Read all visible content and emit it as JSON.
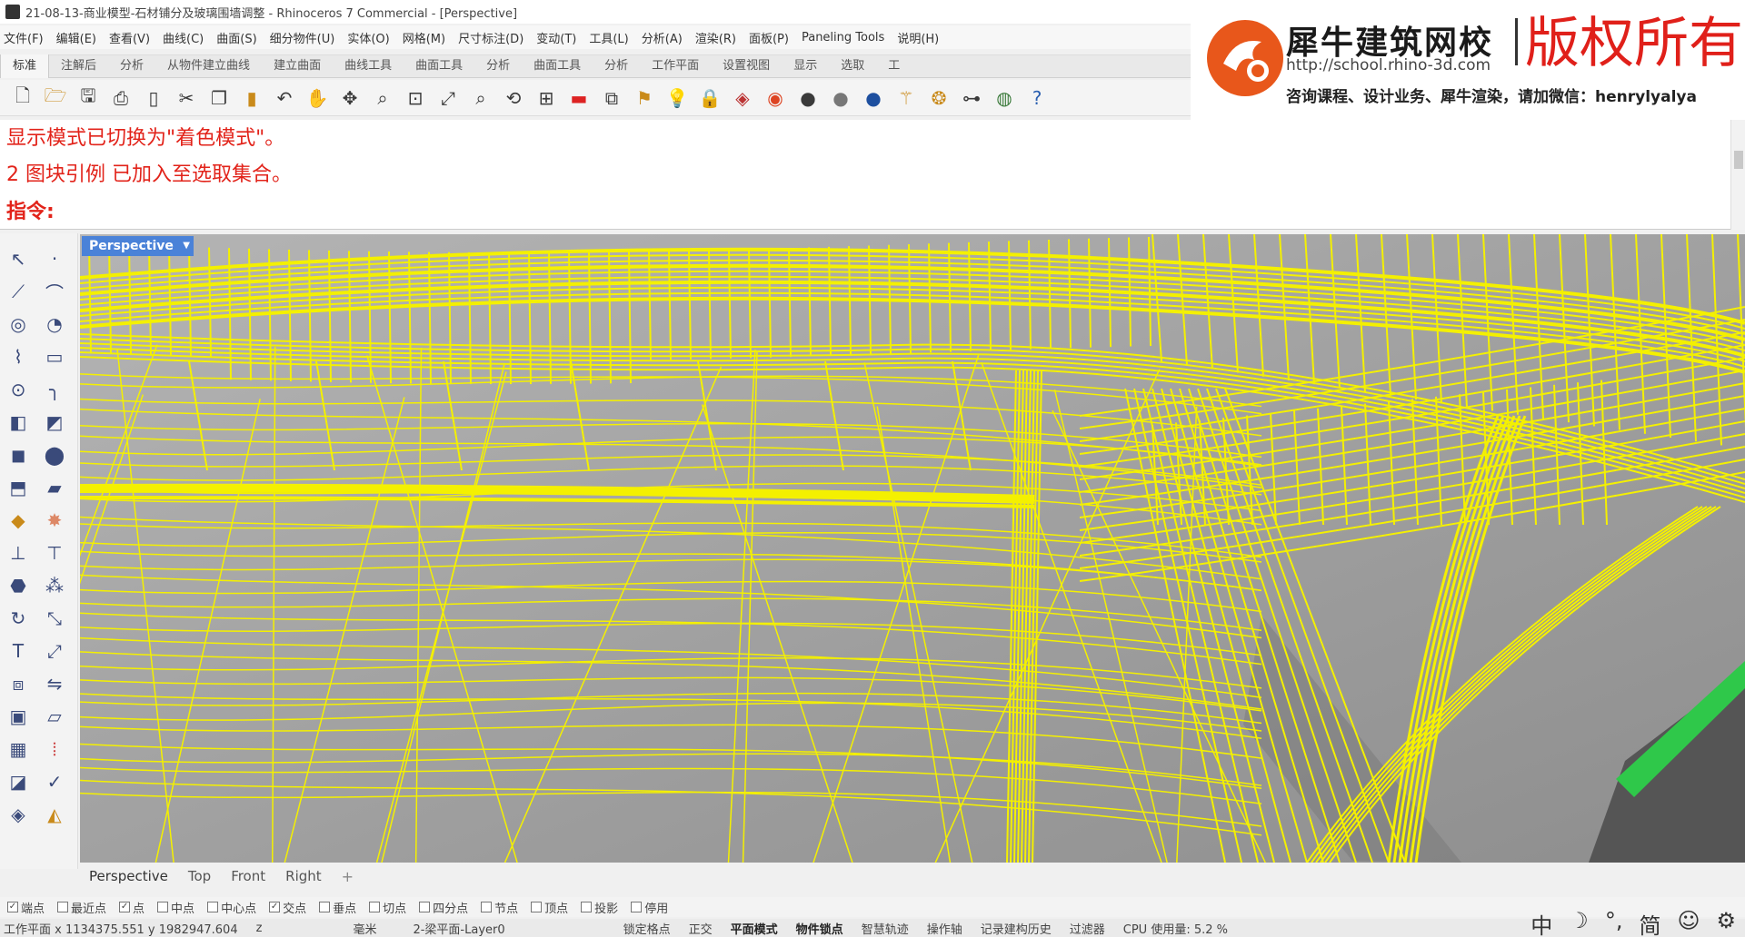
{
  "window": {
    "title": "21-08-13-商业模型-石材铺分及玻璃围墙调整 - Rhinoceros 7 Commercial - [Perspective]"
  },
  "menu": [
    "文件(F)",
    "编辑(E)",
    "查看(V)",
    "曲线(C)",
    "曲面(S)",
    "细分物件(U)",
    "实体(O)",
    "网格(M)",
    "尺寸标注(D)",
    "变动(T)",
    "工具(L)",
    "分析(A)",
    "渲染(R)",
    "面板(P)",
    "Paneling Tools",
    "说明(H)"
  ],
  "tabs": [
    "标准",
    "注解后",
    "分析",
    "从物件建立曲线",
    "建立曲面",
    "曲线工具",
    "曲面工具",
    "分析",
    "曲面工具",
    "分析",
    "工作平面",
    "设置视图",
    "显示",
    "选取",
    "工"
  ],
  "toolbar_icons": [
    "new-file-icon",
    "open-icon",
    "save-icon",
    "print-icon",
    "new-layout-icon",
    "cut-icon",
    "copy-icon",
    "paste-icon",
    "undo-icon",
    "pan-icon",
    "move-icon",
    "zoom-icon",
    "zoom-window-icon",
    "zoom-extents-icon",
    "zoom-selected-icon",
    "rotate-view-icon",
    "four-view-icon",
    "red-line-icon",
    "layer-icon",
    "properties-icon",
    "light-icon",
    "lock-icon",
    "material-icon",
    "color-wheel-icon",
    "sphere-dark-icon",
    "sphere-gray-icon",
    "sphere-blue-icon",
    "wand-icon",
    "render-icon",
    "hierarchy-icon",
    "globe-icon",
    "help-icon"
  ],
  "watermark": {
    "name": "犀牛建筑网校",
    "rights": "版权所有",
    "url": "http://school.rhino-3d.com",
    "services": "咨询课程、设计业务、犀牛渲染，请加微信：henrylyalya"
  },
  "command": {
    "line1": "显示模式已切换为\"着色模式\"。",
    "line2": "2 图块引例 已加入至选取集合。",
    "prompt": "指令:",
    "input_value": ""
  },
  "viewport": {
    "label": "Perspective"
  },
  "view_tabs": [
    "Perspective",
    "Top",
    "Front",
    "Right"
  ],
  "osnaps": [
    {
      "label": "端点",
      "checked": true
    },
    {
      "label": "最近点",
      "checked": false
    },
    {
      "label": "点",
      "checked": true
    },
    {
      "label": "中点",
      "checked": false
    },
    {
      "label": "中心点",
      "checked": false
    },
    {
      "label": "交点",
      "checked": true
    },
    {
      "label": "垂点",
      "checked": false
    },
    {
      "label": "切点",
      "checked": false
    },
    {
      "label": "四分点",
      "checked": false
    },
    {
      "label": "节点",
      "checked": false
    },
    {
      "label": "顶点",
      "checked": false
    },
    {
      "label": "投影",
      "checked": false
    },
    {
      "label": "停用",
      "checked": false
    }
  ],
  "status": {
    "coords": "工作平面 x 1134375.551 y 1982947.604",
    "z": "z",
    "unit": "毫米",
    "layer": "2-梁平面-Layer0",
    "items": [
      "锁定格点",
      "正交",
      "平面模式",
      "物件锁点",
      "智慧轨迹",
      "操作轴",
      "记录建构历史",
      "过滤器",
      "CPU 使用量: 5.2 %"
    ]
  },
  "tray": [
    "中",
    "月亮",
    "°,",
    "简",
    "☺",
    "⚙"
  ],
  "colors": {
    "wireframe": "#f4f000",
    "viewport_bg": "#a7a7a7",
    "command_text": "#e2231a",
    "viewport_label": "#4a82d8"
  }
}
